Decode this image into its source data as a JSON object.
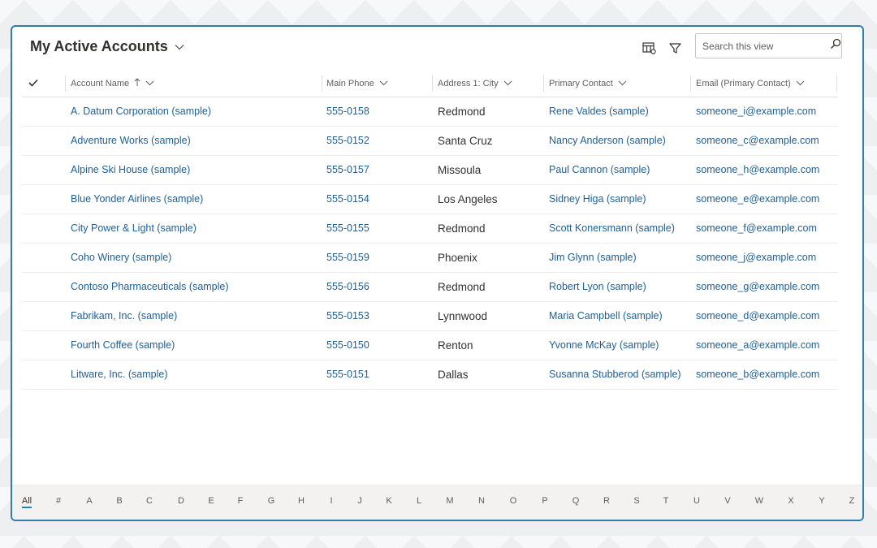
{
  "view": {
    "title": "My Active Accounts",
    "search_placeholder": "Search this view",
    "icons": [
      "chevron-down-icon",
      "edit-columns-icon",
      "filter-icon",
      "search-icon",
      "checkmark-icon",
      "sort-ascending-icon"
    ]
  },
  "columns": {
    "account_name": "Account Name",
    "main_phone": "Main Phone",
    "city": "Address 1: City",
    "primary_contact": "Primary Contact",
    "email": "Email (Primary Contact)"
  },
  "rows": [
    {
      "name": "A. Datum Corporation (sample)",
      "phone": "555-0158",
      "city": "Redmond",
      "contact": "Rene Valdes (sample)",
      "email": "someone_i@example.com"
    },
    {
      "name": "Adventure Works (sample)",
      "phone": "555-0152",
      "city": "Santa Cruz",
      "contact": "Nancy Anderson (sample)",
      "email": "someone_c@example.com"
    },
    {
      "name": "Alpine Ski House (sample)",
      "phone": "555-0157",
      "city": "Missoula",
      "contact": "Paul Cannon (sample)",
      "email": "someone_h@example.com"
    },
    {
      "name": "Blue Yonder Airlines (sample)",
      "phone": "555-0154",
      "city": "Los Angeles",
      "contact": "Sidney Higa (sample)",
      "email": "someone_e@example.com"
    },
    {
      "name": "City Power & Light (sample)",
      "phone": "555-0155",
      "city": "Redmond",
      "contact": "Scott Konersmann (sample)",
      "email": "someone_f@example.com"
    },
    {
      "name": "Coho Winery (sample)",
      "phone": "555-0159",
      "city": "Phoenix",
      "contact": "Jim Glynn (sample)",
      "email": "someone_j@example.com"
    },
    {
      "name": "Contoso Pharmaceuticals (sample)",
      "phone": "555-0156",
      "city": "Redmond",
      "contact": "Robert Lyon (sample)",
      "email": "someone_g@example.com"
    },
    {
      "name": "Fabrikam, Inc. (sample)",
      "phone": "555-0153",
      "city": "Lynnwood",
      "contact": "Maria Campbell (sample)",
      "email": "someone_d@example.com"
    },
    {
      "name": "Fourth Coffee (sample)",
      "phone": "555-0150",
      "city": "Renton",
      "contact": "Yvonne McKay (sample)",
      "email": "someone_a@example.com"
    },
    {
      "name": "Litware, Inc. (sample)",
      "phone": "555-0151",
      "city": "Dallas",
      "contact": "Susanna Stubberod (sample)",
      "email": "someone_b@example.com"
    }
  ],
  "jump_bar": {
    "items": [
      "All",
      "#",
      "A",
      "B",
      "C",
      "D",
      "E",
      "F",
      "G",
      "H",
      "I",
      "J",
      "K",
      "L",
      "M",
      "N",
      "O",
      "P",
      "Q",
      "R",
      "S",
      "T",
      "U",
      "V",
      "W",
      "X",
      "Y",
      "Z"
    ],
    "selected": "All"
  },
  "colors": {
    "accent": "#2f7fa8",
    "link": "#1f5f93"
  }
}
